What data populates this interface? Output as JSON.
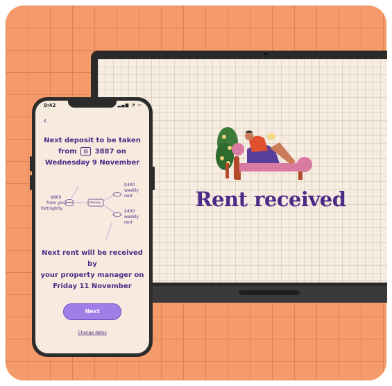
{
  "colors": {
    "background": "#f59a6a",
    "accent": "#4b2b86",
    "button": "#a07ee8"
  },
  "laptop": {
    "headline": "Rent received"
  },
  "phone": {
    "status_time": "9:42",
    "status_icons": "▂▄▆ ◔ ▭",
    "back_icon": "chevron-left-icon",
    "deposit_line1": "Next deposit to be taken",
    "deposit_from": "from",
    "deposit_account": "3887 on",
    "deposit_date": "Wednesday 9 November",
    "diagram": {
      "from_amount": "$800",
      "from_label1": "from you",
      "from_label2": "fortnightly",
      "center_label": "afterpay",
      "rent1_amount": "$400",
      "rent1_label1": "weekly",
      "rent1_label2": "rent",
      "rent2_amount": "$400",
      "rent2_label1": "weekly",
      "rent2_label2": "rent"
    },
    "received_line1": "Next rent will be received by",
    "received_line2": "your property manager on",
    "received_line3": "Friday 11 November",
    "next_button": "Next",
    "change_dates_link": "Change dates"
  }
}
